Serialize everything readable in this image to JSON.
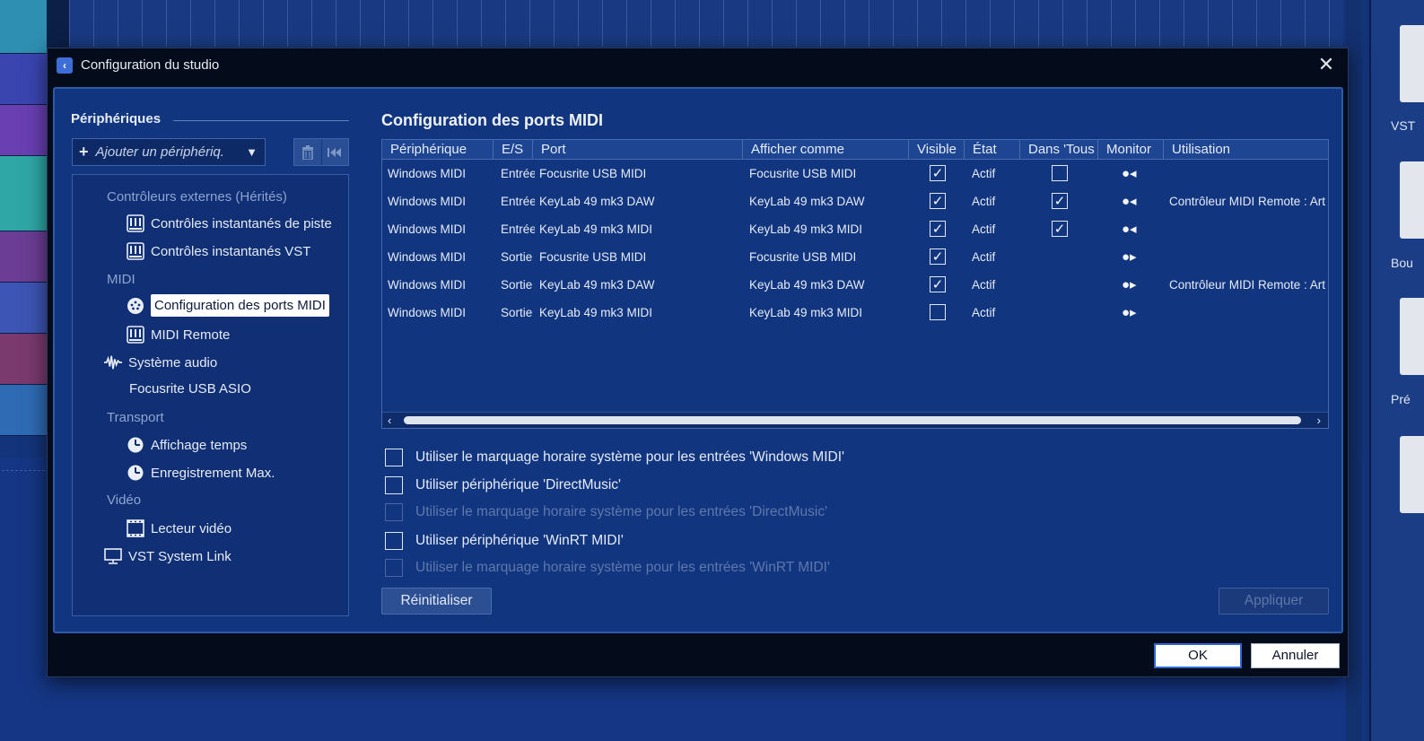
{
  "window": {
    "title": "Configuration du studio",
    "close_glyph": "✕"
  },
  "background": {
    "right_labels": [
      "VST",
      "Bou",
      "Pré"
    ]
  },
  "left": {
    "section_title": "Périphériques",
    "add_device": {
      "plus": "+",
      "label": "Ajouter un périphériq.",
      "arrow": "▼"
    },
    "toolbar_icons": [
      "trash-icon",
      "reset-icon"
    ],
    "tree": [
      {
        "label": "Contrôleurs externes (Hérités)",
        "type": "category",
        "icon": ""
      },
      {
        "label": "Contrôles instantanés de piste",
        "type": "item",
        "icon": "controller-icon"
      },
      {
        "label": "Contrôles instantanés VST",
        "type": "item",
        "icon": "controller-icon"
      },
      {
        "label": "MIDI",
        "type": "category",
        "icon": ""
      },
      {
        "label": "Configuration des ports MIDI",
        "type": "item",
        "icon": "midi-port-icon",
        "selected": true
      },
      {
        "label": "MIDI Remote",
        "type": "item",
        "icon": "controller-icon"
      },
      {
        "label": "Système audio",
        "type": "root",
        "icon": "waveform-icon"
      },
      {
        "label": "Focusrite USB ASIO",
        "type": "subitem",
        "icon": ""
      },
      {
        "label": "Transport",
        "type": "category",
        "icon": ""
      },
      {
        "label": "Affichage temps",
        "type": "item",
        "icon": "clock-icon"
      },
      {
        "label": "Enregistrement Max.",
        "type": "item",
        "icon": "clock-icon"
      },
      {
        "label": "Vidéo",
        "type": "category",
        "icon": ""
      },
      {
        "label": "Lecteur vidéo",
        "type": "item",
        "icon": "film-icon"
      },
      {
        "label": "VST System Link",
        "type": "root",
        "icon": "monitor-icon"
      }
    ]
  },
  "main": {
    "title": "Configuration des ports MIDI",
    "columns": [
      "Périphérique",
      "E/S",
      "Port",
      "Afficher comme",
      "Visible",
      "État",
      "Dans 'Tous",
      "Monitor",
      "Utilisation"
    ],
    "rows": [
      {
        "device": "Windows MIDI",
        "io": "Entrée",
        "port": "Focusrite USB MIDI",
        "show_as": "Focusrite USB MIDI",
        "visible": true,
        "state": "Actif",
        "in_all": false,
        "monitor": "in",
        "usage": ""
      },
      {
        "device": "Windows MIDI",
        "io": "Entrée",
        "port": "KeyLab 49 mk3 DAW",
        "show_as": "KeyLab 49 mk3 DAW",
        "visible": true,
        "state": "Actif",
        "in_all": true,
        "monitor": "in",
        "usage": "Contrôleur MIDI Remote : Art"
      },
      {
        "device": "Windows MIDI",
        "io": "Entrée",
        "port": "KeyLab 49 mk3 MIDI",
        "show_as": "KeyLab 49 mk3 MIDI",
        "visible": true,
        "state": "Actif",
        "in_all": true,
        "monitor": "in",
        "usage": ""
      },
      {
        "device": "Windows MIDI",
        "io": "Sortie",
        "port": "Focusrite USB MIDI",
        "show_as": "Focusrite USB MIDI",
        "visible": true,
        "state": "Actif",
        "in_all": null,
        "monitor": "out",
        "usage": ""
      },
      {
        "device": "Windows MIDI",
        "io": "Sortie",
        "port": "KeyLab 49 mk3 DAW",
        "show_as": "KeyLab 49 mk3 DAW",
        "visible": true,
        "state": "Actif",
        "in_all": null,
        "monitor": "out",
        "usage": "Contrôleur MIDI Remote : Art"
      },
      {
        "device": "Windows MIDI",
        "io": "Sortie",
        "port": "KeyLab 49 mk3 MIDI",
        "show_as": "KeyLab 49 mk3 MIDI",
        "visible": false,
        "state": "Actif",
        "in_all": null,
        "monitor": "out",
        "usage": ""
      }
    ],
    "options": [
      {
        "label": "Utiliser le marquage horaire système pour les entrées 'Windows MIDI'",
        "checked": false,
        "enabled": true
      },
      {
        "label": "Utiliser périphérique 'DirectMusic'",
        "checked": false,
        "enabled": true
      },
      {
        "label": "Utiliser le marquage horaire système pour les entrées 'DirectMusic'",
        "checked": false,
        "enabled": false
      },
      {
        "label": "Utiliser périphérique 'WinRT MIDI'",
        "checked": false,
        "enabled": true
      },
      {
        "label": "Utiliser le marquage horaire système pour les entrées 'WinRT MIDI'",
        "checked": false,
        "enabled": false
      }
    ],
    "reset_label": "Réinitialiser",
    "apply_label": "Appliquer"
  },
  "footer": {
    "ok_label": "OK",
    "cancel_label": "Annuler"
  },
  "colors": {
    "panel": "#123580",
    "header": "#1d4592",
    "dialog_frame": "#040b1b",
    "accent": "#2e66d6"
  }
}
